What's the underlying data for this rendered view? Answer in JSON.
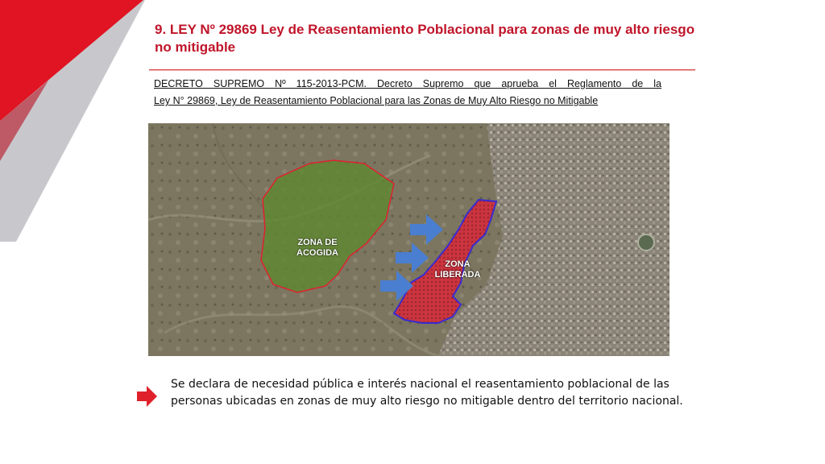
{
  "slide": {
    "title": "9. LEY Nº 29869 Ley de Reasentamiento Poblacional para zonas de muy alto riesgo no mitigable",
    "decree_line1": "DECRETO SUPREMO Nº 115-2013-PCM. Decreto Supremo que aprueba el Reglamento de la",
    "decree_line2": "Ley N° 29869, Ley de Reasentamiento Poblacional para las Zonas de Muy Alto Riesgo no Mitigable",
    "declaration": "Se declara de necesidad pública e interés nacional el reasentamiento poblacional de las personas ubicadas en zonas de muy alto riesgo no mitigable  dentro del territorio nacional."
  },
  "map": {
    "label_acogida": "ZONA DE ACOGIDA",
    "label_liberada": "ZONA LIBERADA"
  },
  "colors": {
    "accent_red": "#c0152a",
    "deco_grey": "#c8c8cc",
    "arrow_red": "#e0202a",
    "zone_green": "#6a9a3a",
    "zone_red": "#e02030",
    "zone_border_blue": "#3a2ad0",
    "move_arrow_blue": "#4a7ed0"
  }
}
